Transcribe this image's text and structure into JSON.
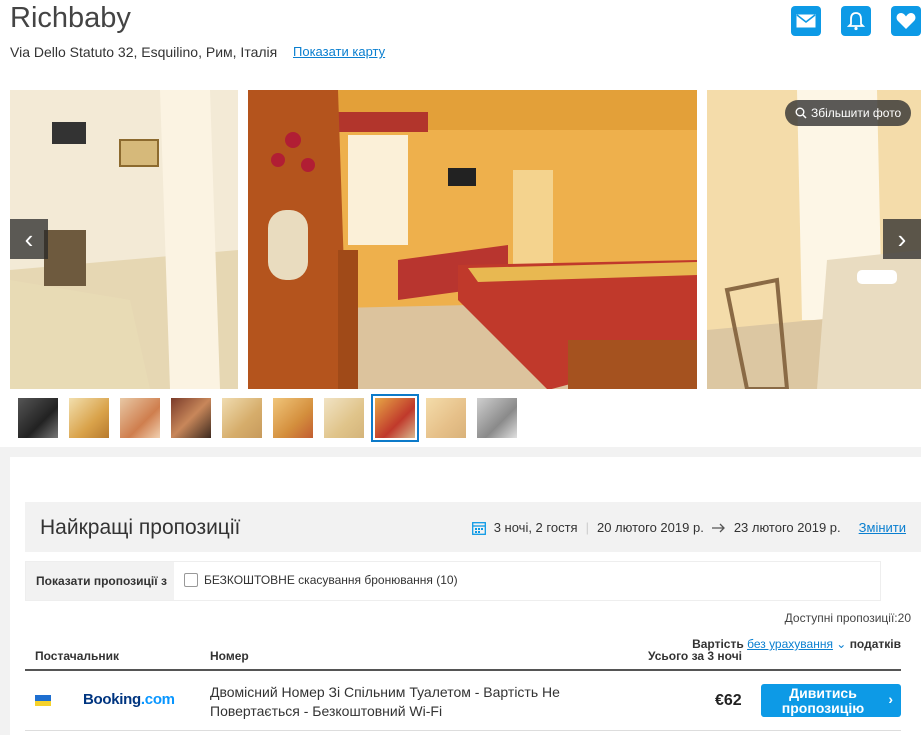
{
  "hotel": {
    "name": "Richbaby",
    "address": "Via Dello Statuto 32, Esquilino, Рим, Італія",
    "map_link": "Показати карту"
  },
  "gallery": {
    "zoom_label": "Збільшити фото",
    "thumbnail_count": 10,
    "active_thumbnail": 8
  },
  "offers": {
    "title": "Найкращі пропозиції",
    "stay_summary": "3 ночі, 2 гостя",
    "checkin": "20 лютого 2019 р.",
    "checkout": "23 лютого 2019 р.",
    "change_label": "Змінити",
    "filter_label": "Показати пропозиції з",
    "filter_option": "БЕЗКОШТОВНЕ скасування бронювання (10)",
    "available": "Доступні пропозиції:20",
    "columns": {
      "provider": "Постачальник",
      "room": "Номер",
      "total": "Усього за 3 ночі",
      "price_prefix": "Вартість",
      "price_link": "без урахування",
      "price_suffix": "податків"
    },
    "rows": [
      {
        "provider_name": "Booking",
        "provider_suffix": ".com",
        "room": "Двомісний Номер Зі Спільним Туалетом - Вартість Не Повертається - Безкоштовний Wi-Fi",
        "price": "€62",
        "cta": "Дивитись пропозицію"
      }
    ]
  },
  "colors": {
    "accent": "#0d9ae6",
    "link": "#0a7fd0",
    "booking_brand": "#003580"
  },
  "icons": [
    "envelope-icon",
    "bell-icon",
    "heart-icon",
    "calendar-icon",
    "zoom-icon",
    "arrow-right-icon",
    "chevron-right-icon",
    "chevron-left-icon",
    "chevron-down-icon"
  ]
}
